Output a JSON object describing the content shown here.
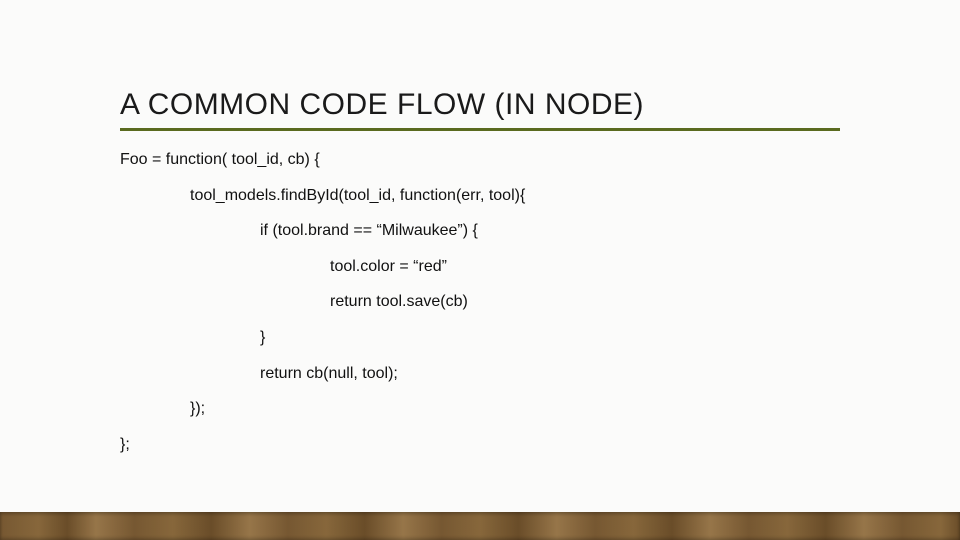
{
  "title": "A COMMON CODE FLOW (IN NODE)",
  "code": {
    "l1": "Foo = function( tool_id, cb) {",
    "l2": "tool_models.findById(tool_id, function(err, tool){",
    "l3": "if (tool.brand == “Milwaukee”) {",
    "l4": "tool.color = “red”",
    "l5": "return tool.save(cb)",
    "l6": "}",
    "l7": "return cb(null, tool);",
    "l8": "});",
    "l9": "};"
  }
}
